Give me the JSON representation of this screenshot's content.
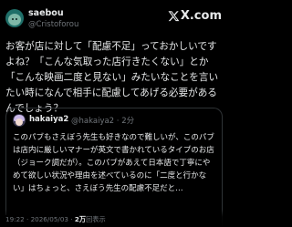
{
  "author": {
    "display_name": "saebou",
    "handle": "@Cristoforou",
    "avatar_icon": "avatar-icon"
  },
  "brand": {
    "name": "X.com",
    "icon": "x-logo-icon"
  },
  "tweet": {
    "text": "お客が店に対して「配慮不足」っておかしいですよね？「こんな気取った店行きたくない」とか「こんな映画二度と見ない」みたいなことを言いたい時になんで相手に配慮してあげる必要があるんでしょう？"
  },
  "quoted_tweet": {
    "display_name": "hakaiya2",
    "handle": "@hakaiya2 · 2分",
    "text": "このパブもさえぼう先生も好きなので難しいが、このパブは店内に厳しいマナーが英文で書かれているタイプのお店（ジョーク調だが）。このパブがあえて日本語で丁寧にやめて欲しい状況や理由を述べているのに「二度と行かない」はちょっと、さえぼう先生の配慮不足だと…"
  },
  "meta": {
    "timestamp": "19:22 · 2026/05/03 · ",
    "views": "2万",
    "views_suffix": "回表示"
  },
  "colors": {
    "background": "#000000",
    "primary_text": "#e7e9ea",
    "secondary_text": "#71767b",
    "border": "#2f3336"
  }
}
